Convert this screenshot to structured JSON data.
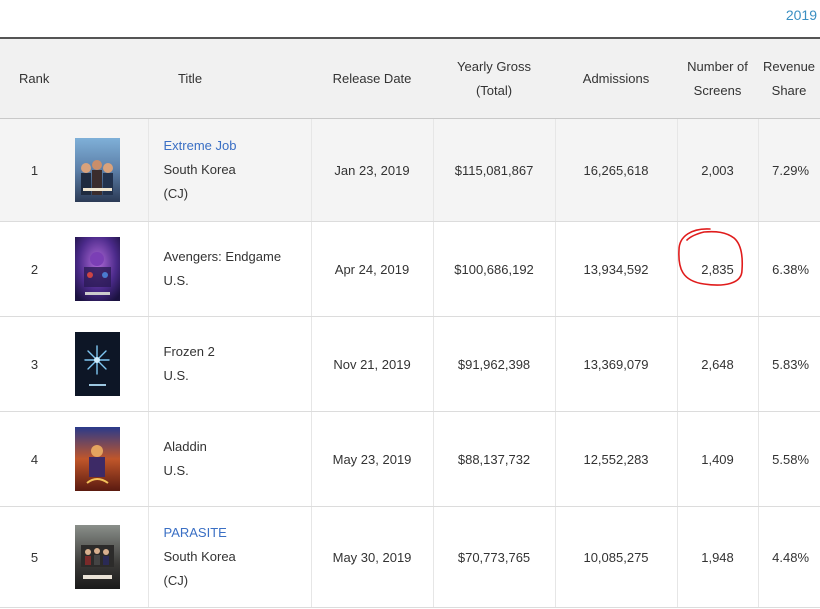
{
  "year_link": "2019",
  "columns": {
    "rank": "Rank",
    "title": "Title",
    "release_date": "Release Date",
    "yearly_gross_line1": "Yearly Gross",
    "yearly_gross_line2": "(Total)",
    "admissions": "Admissions",
    "screens_line1": "Number of",
    "screens_line2": "Screens",
    "share_line1": "Revenue",
    "share_line2": "Share"
  },
  "rows": [
    {
      "rank": "1",
      "title": "Extreme Job",
      "country": "South Korea",
      "distributor": "(CJ)",
      "release_date": "Jan 23, 2019",
      "gross": "$115,081,867",
      "admissions": "16,265,618",
      "screens": "2,003",
      "share": "7.29%"
    },
    {
      "rank": "2",
      "title": "Avengers: Endgame",
      "country": "U.S.",
      "distributor": "",
      "release_date": "Apr 24, 2019",
      "gross": "$100,686,192",
      "admissions": "13,934,592",
      "screens": "2,835",
      "share": "6.38%"
    },
    {
      "rank": "3",
      "title": "Frozen 2",
      "country": "U.S.",
      "distributor": "",
      "release_date": "Nov 21, 2019",
      "gross": "$91,962,398",
      "admissions": "13,369,079",
      "screens": "2,648",
      "share": "5.83%"
    },
    {
      "rank": "4",
      "title": "Aladdin",
      "country": "U.S.",
      "distributor": "",
      "release_date": "May 23, 2019",
      "gross": "$88,137,732",
      "admissions": "12,552,283",
      "screens": "1,409",
      "share": "5.58%"
    },
    {
      "rank": "5",
      "title": "PARASITE",
      "country": "South Korea",
      "distributor": "(CJ)",
      "release_date": "May 30, 2019",
      "gross": "$70,773,765",
      "admissions": "10,085,275",
      "screens": "1,948",
      "share": "4.48%"
    }
  ],
  "colors": {
    "link": "#3a6fc4",
    "header_bg": "#f1f1f1",
    "annotation": "#e01c1c"
  }
}
